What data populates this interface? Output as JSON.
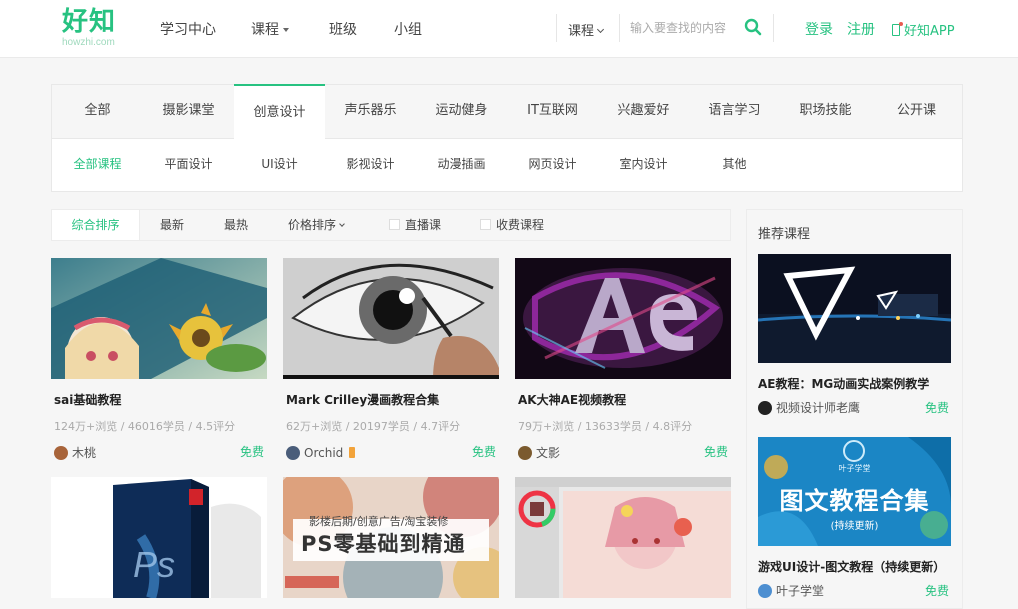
{
  "header": {
    "logo_cn": "好知",
    "logo_en": "howzhi.com",
    "nav": [
      "学习中心",
      "课程",
      "班级",
      "小组"
    ],
    "search_type": "课程",
    "search_placeholder": "输入要查找的内容",
    "login": "登录",
    "register": "注册",
    "app": "好知APP"
  },
  "categories": {
    "tabs": [
      "全部",
      "摄影课堂",
      "创意设计",
      "声乐器乐",
      "运动健身",
      "IT互联网",
      "兴趣爱好",
      "语言学习",
      "职场技能",
      "公开课"
    ],
    "active_tab": "创意设计",
    "subtabs": [
      "全部课程",
      "平面设计",
      "UI设计",
      "影视设计",
      "动漫插画",
      "网页设计",
      "室内设计",
      "其他"
    ],
    "active_subtab": "全部课程"
  },
  "sortbar": {
    "items": [
      "综合排序",
      "最新",
      "最热",
      "价格排序"
    ],
    "filters": [
      "直播课",
      "收费课程"
    ]
  },
  "courses": [
    {
      "title": "sai基础教程",
      "stats": "124万+浏览 / 46016学员 / 4.5评分",
      "author": "木桃",
      "price": "免费"
    },
    {
      "title": "Mark Crilley漫画教程合集",
      "stats": "62万+浏览 / 20197学员 / 4.7评分",
      "author": "Orchid",
      "price": "免费"
    },
    {
      "title": "AK大神AE视频教程",
      "stats": "79万+浏览 / 13633学员 / 4.8评分",
      "author": "文影",
      "price": "免费"
    }
  ],
  "row2": {
    "ps_banner_top": "影楼后期/创意广告/淘宝装修",
    "ps_banner_main": "PS零基础到精通"
  },
  "sidebar": {
    "title": "推荐课程",
    "items": [
      {
        "title": "AE教程：MG动画实战案例教学",
        "author": "视频设计师老鹰",
        "price": "免费"
      },
      {
        "title": "游戏UI设计-图文教程（持续更新）",
        "author": "叶子学堂",
        "price": "免费",
        "banner_main": "图文教程合集",
        "banner_sub": "(持续更新)",
        "banner_brand": "叶子学堂"
      }
    ]
  },
  "colors": {
    "accent": "#27c281"
  }
}
